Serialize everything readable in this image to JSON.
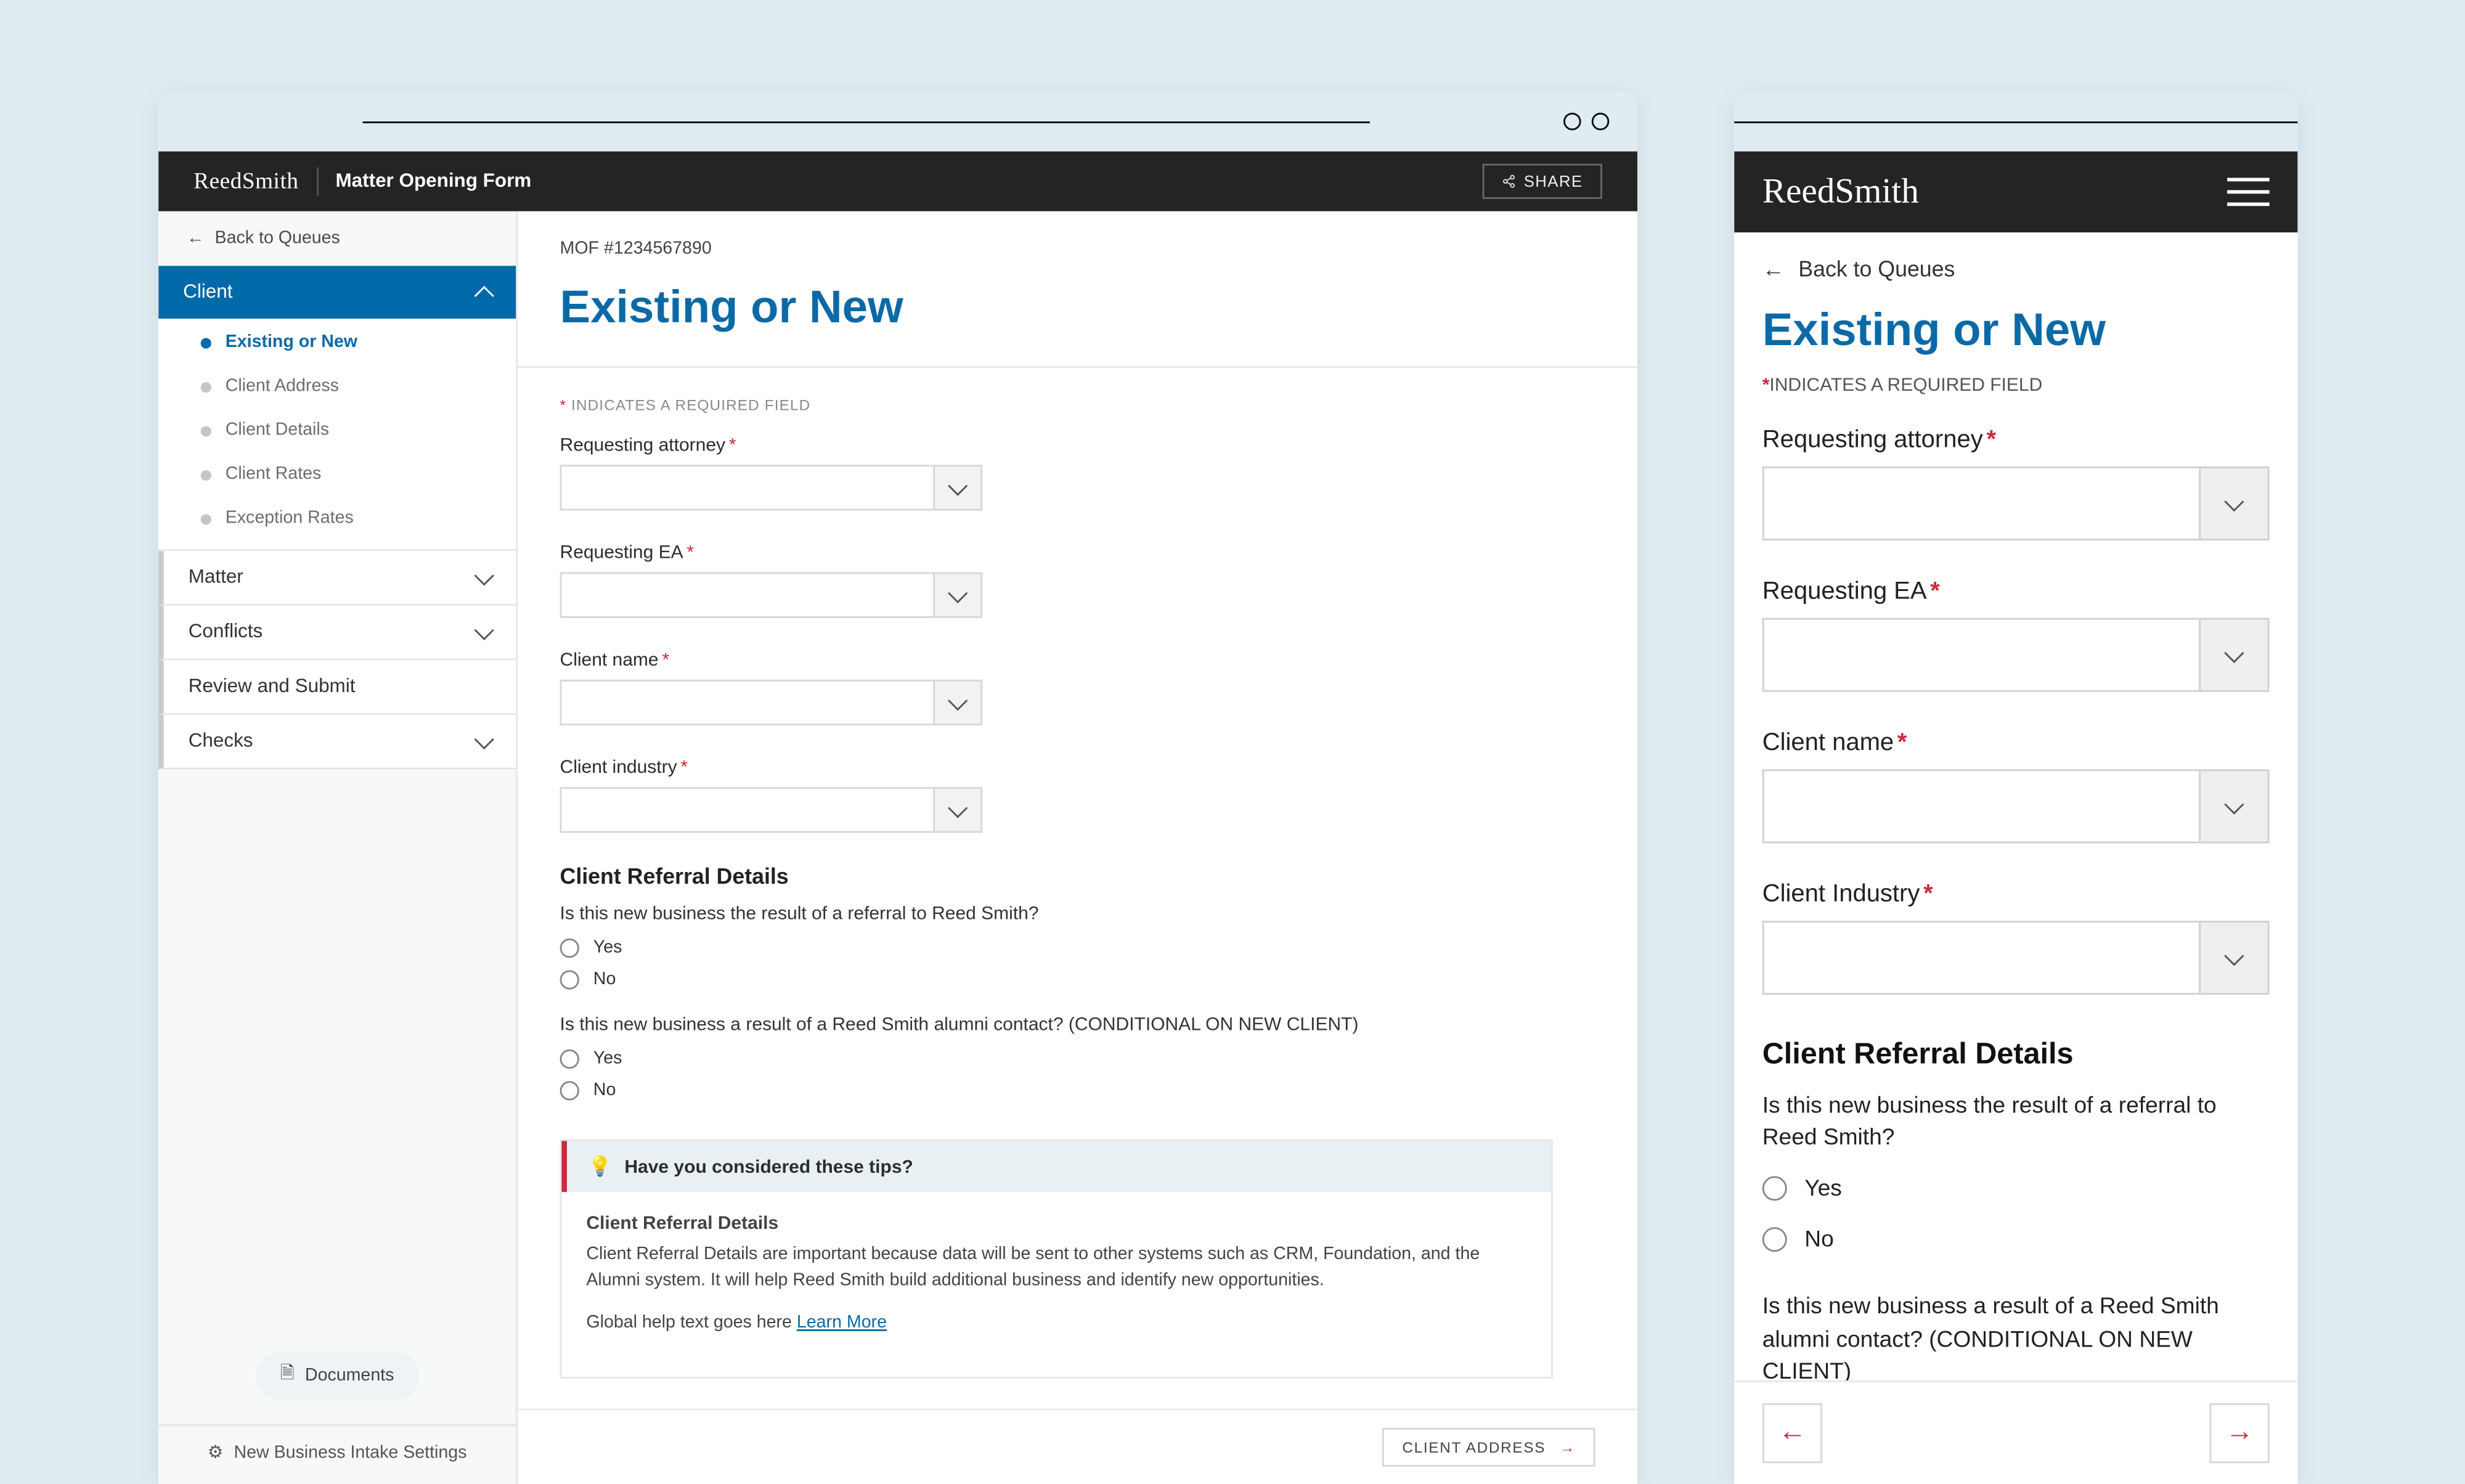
{
  "desktop": {
    "header": {
      "brand": "ReedSmith",
      "title": "Matter Opening Form",
      "share_label": "SHARE"
    },
    "sidebar": {
      "back_label": "Back to Queues",
      "sections": {
        "client": {
          "label": "Client",
          "items": [
            "Existing or New",
            "Client Address",
            "Client Details",
            "Client Rates",
            "Exception Rates"
          ]
        },
        "matter": "Matter",
        "conflicts": "Conflicts",
        "review": "Review and Submit",
        "checks": "Checks"
      },
      "documents_label": "Documents",
      "settings_label": "New Business Intake Settings"
    },
    "main": {
      "mof_id": "MOF #1234567890",
      "title": "Existing or New",
      "required_note": "INDICATES A REQUIRED FIELD",
      "fields": {
        "attorney": "Requesting attorney",
        "ea": "Requesting EA",
        "client_name": "Client name",
        "client_industry": "Client industry"
      },
      "referral_heading": "Client Referral Details",
      "q1": "Is this new business the result of a referral to Reed Smith?",
      "q2": "Is this new business a result of a Reed Smith alumni contact? (CONDITIONAL ON NEW CLIENT)",
      "yes": "Yes",
      "no": "No",
      "tips": {
        "title": "Have you considered these tips?",
        "h": "Client Referral Details",
        "body": "Client Referral Details are important because data will be sent to other systems such as CRM, Foundation, and the Alumni system. It will help Reed Smith build additional business and identify new opportunities.",
        "footer_pre": "Global help text goes here ",
        "learn_more": "Learn More"
      },
      "next_label": "CLIENT ADDRESS"
    }
  },
  "mobile": {
    "brand": "ReedSmith",
    "back_label": "Back to Queues",
    "title": "Existing or New",
    "required_note": "INDICATES A REQUIRED FIELD",
    "fields": {
      "attorney": "Requesting attorney",
      "ea": "Requesting EA",
      "client_name": "Client name",
      "client_industry": "Client Industry"
    },
    "referral_heading": "Client Referral Details",
    "q1": "Is this new business the result of a referral to Reed Smith?",
    "q2": "Is this new business a result of a Reed Smith alumni contact? (CONDITIONAL ON NEW CLIENT)",
    "yes": "Yes",
    "no": "No"
  }
}
